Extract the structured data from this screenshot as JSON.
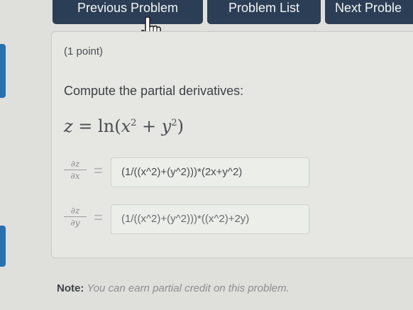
{
  "nav": {
    "previous_label": "Previous Problem",
    "list_label": "Problem List",
    "next_label": "Next Proble"
  },
  "problem": {
    "points": "(1 point)",
    "instruction": "Compute the partial derivatives:",
    "equation": {
      "lhs": "z",
      "eq": "=",
      "func": "ln",
      "open": "(",
      "x": "x",
      "x_exp": "2",
      "plus": "+",
      "y": "y",
      "y_exp": "2",
      "close": ")"
    },
    "derivatives": [
      {
        "num": "∂z",
        "den": "∂x",
        "eq": "=",
        "answer": "(1/((x^2)+(y^2)))*(2x+y^2)"
      },
      {
        "num": "∂z",
        "den": "∂y",
        "eq": "=",
        "answer": "(1/((x^2)+(y^2)))*((x^2)+2y)"
      }
    ]
  },
  "note": {
    "label": "Note:",
    "text": "You can earn partial credit on this problem."
  },
  "icons": {
    "cursor": "hand-pointer-icon"
  },
  "colors": {
    "nav_bg": "#2c3e55",
    "nav_text": "#f3f5f7",
    "accent_bar": "#2a6fb0"
  }
}
